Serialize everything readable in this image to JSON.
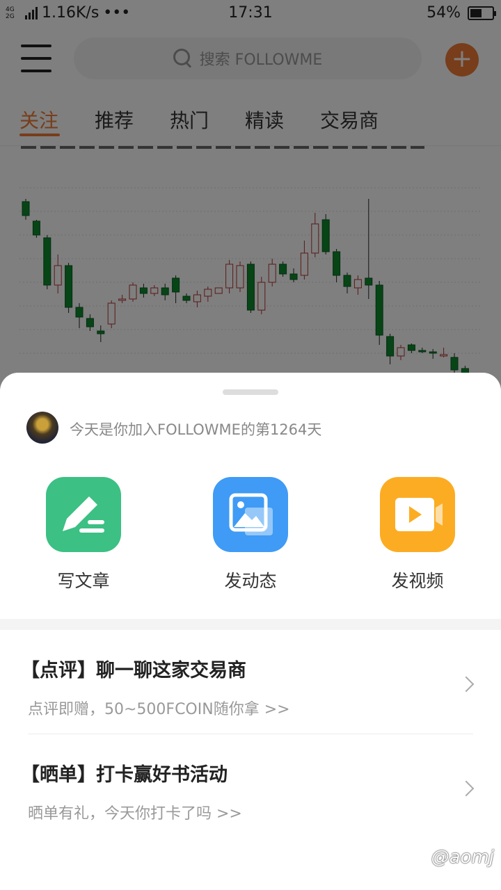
{
  "status_bar": {
    "network": "4G",
    "speed": "1.16K/s",
    "dots": "•••",
    "time": "17:31",
    "battery": "54%",
    "battery_level": 0.54
  },
  "header": {
    "search_placeholder": "搜索 FOLLOWME",
    "add_icon": "plus-icon"
  },
  "tabs": [
    {
      "label": "关注",
      "active": true
    },
    {
      "label": "推荐",
      "active": false
    },
    {
      "label": "热门",
      "active": false
    },
    {
      "label": "精读",
      "active": false
    },
    {
      "label": "交易商",
      "active": false
    }
  ],
  "colors": {
    "accent": "#f07a35",
    "write_green": "#3cc083",
    "post_blue": "#3f9bf5",
    "video_orange": "#fcac23",
    "candle_up": "#b5352f",
    "candle_down": "#0e8a2f"
  },
  "sheet": {
    "join_text": "今天是你加入FOLLOWME的第1264天",
    "actions": [
      {
        "label": "写文章",
        "icon": "pen-icon"
      },
      {
        "label": "发动态",
        "icon": "image-icon"
      },
      {
        "label": "发视频",
        "icon": "video-icon"
      }
    ],
    "promos": [
      {
        "title": "【点评】聊一聊这家交易商",
        "subtitle": "点评即赠，50~500FCOIN随你拿 >>"
      },
      {
        "title": "【晒单】打卡赢好书活动",
        "subtitle": "晒单有礼，今天你打卡了吗 >>"
      }
    ]
  },
  "watermark": "@aomj"
}
